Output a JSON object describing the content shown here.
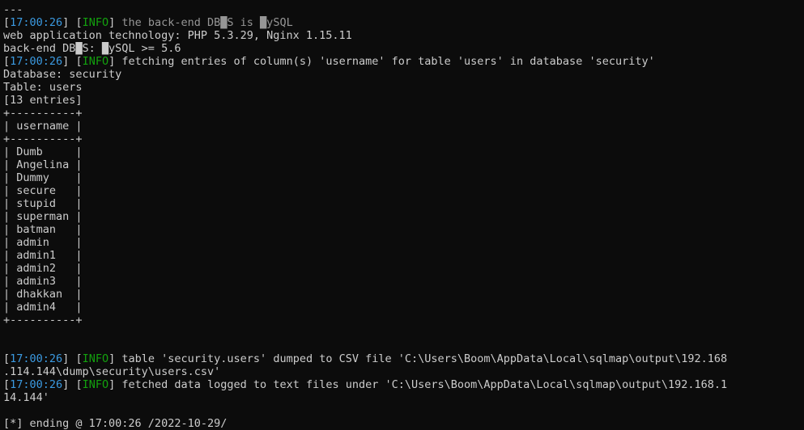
{
  "terminal": {
    "app": "sqlmap-console",
    "colors": {
      "background": "#0c0c0c",
      "foreground": "#cccccc",
      "timestamp": "#3b9ae1",
      "info": "#13a10e",
      "dim_message": "#969696"
    },
    "lines": [
      {
        "type": "plain",
        "text": "---"
      },
      {
        "type": "log",
        "bracket_open": "[",
        "timestamp": "17:00:26",
        "bracket_close": "]",
        "level_open": "[",
        "level": "INFO",
        "level_close": "]",
        "message": " the back-end DB█S is █ySQL",
        "dim": true
      },
      {
        "type": "plain",
        "text": "web application technology: PHP 5.3.29, Nginx 1.15.11"
      },
      {
        "type": "plain",
        "text": "back-end DB█S: █ySQL >= 5.6"
      },
      {
        "type": "log",
        "bracket_open": "[",
        "timestamp": "17:00:26",
        "bracket_close": "]",
        "level_open": "[",
        "level": "INFO",
        "level_close": "]",
        "message": " fetching entries of column(s) 'username' for table 'users' in database 'security'",
        "dim": false
      },
      {
        "type": "plain",
        "text": "Database: security"
      },
      {
        "type": "plain",
        "text": "Table: users"
      },
      {
        "type": "plain",
        "text": "[13 entries]"
      },
      {
        "type": "table",
        "text": "+----------+"
      },
      {
        "type": "table",
        "text": "| username |"
      },
      {
        "type": "table",
        "text": "+----------+"
      },
      {
        "type": "table",
        "text": "| Dumb     |"
      },
      {
        "type": "table",
        "text": "| Angelina |"
      },
      {
        "type": "table",
        "text": "| Dummy    |"
      },
      {
        "type": "table",
        "text": "| secure   |"
      },
      {
        "type": "table",
        "text": "| stupid   |"
      },
      {
        "type": "table",
        "text": "| superman |"
      },
      {
        "type": "table",
        "text": "| batman   |"
      },
      {
        "type": "table",
        "text": "| admin    |"
      },
      {
        "type": "table",
        "text": "| admin1   |"
      },
      {
        "type": "table",
        "text": "| admin2   |"
      },
      {
        "type": "table",
        "text": "| admin3   |"
      },
      {
        "type": "table",
        "text": "| dhakkan  |"
      },
      {
        "type": "table",
        "text": "| admin4   |"
      },
      {
        "type": "table",
        "text": "+----------+"
      },
      {
        "type": "blank",
        "text": ""
      },
      {
        "type": "blank",
        "text": ""
      },
      {
        "type": "log",
        "bracket_open": "[",
        "timestamp": "17:00:26",
        "bracket_close": "]",
        "level_open": "[",
        "level": "INFO",
        "level_close": "]",
        "message": " table 'security.users' dumped to CSV file 'C:\\Users\\Boom\\AppData\\Local\\sqlmap\\output\\192.168",
        "dim": false
      },
      {
        "type": "plain",
        "text": ".114.144\\dump\\security\\users.csv'"
      },
      {
        "type": "log",
        "bracket_open": "[",
        "timestamp": "17:00:26",
        "bracket_close": "]",
        "level_open": "[",
        "level": "INFO",
        "level_close": "]",
        "message": " fetched data logged to text files under 'C:\\Users\\Boom\\AppData\\Local\\sqlmap\\output\\192.168.1",
        "dim": false
      },
      {
        "type": "plain",
        "text": "14.144'"
      },
      {
        "type": "blank",
        "text": ""
      },
      {
        "type": "plain",
        "text": "[*] ending @ 17:00:26 /2022-10-29/"
      }
    ]
  }
}
